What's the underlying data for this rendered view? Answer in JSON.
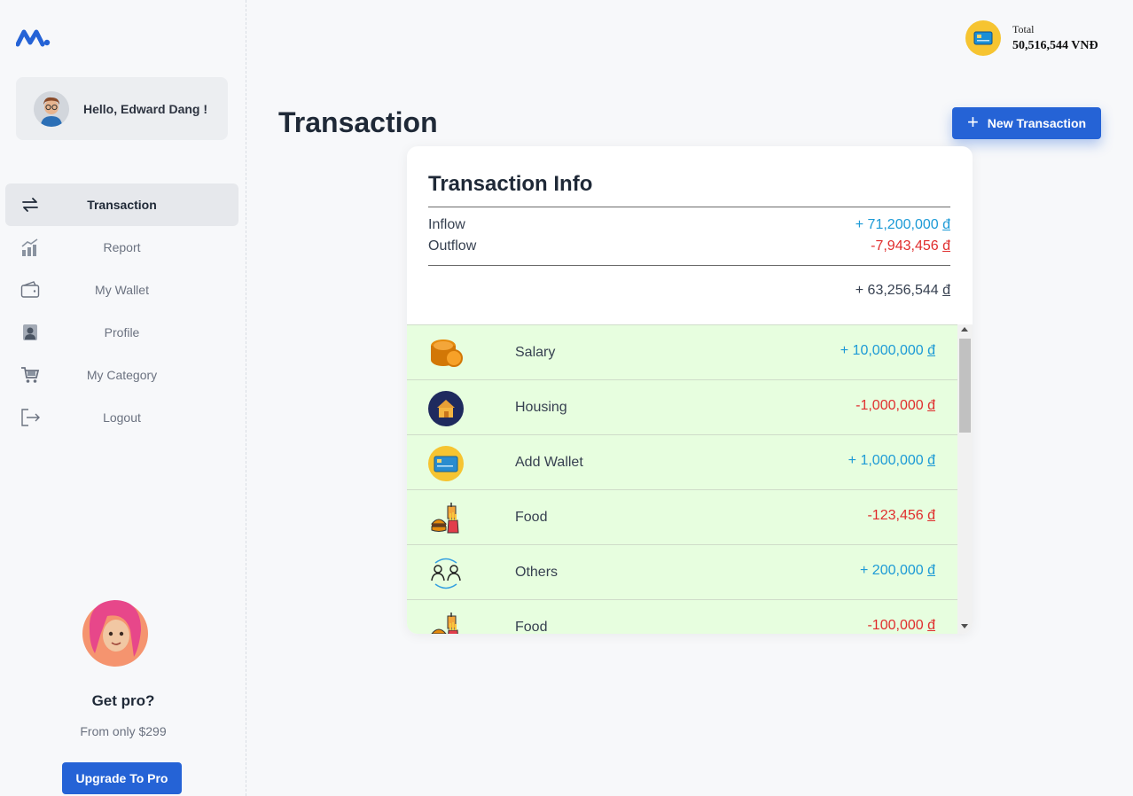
{
  "user": {
    "greeting": "Hello, Edward Dang !"
  },
  "sidebar": {
    "items": [
      {
        "label": "Transaction",
        "icon": "transfer-arrows-icon",
        "active": true
      },
      {
        "label": "Report",
        "icon": "chart-icon"
      },
      {
        "label": "My Wallet",
        "icon": "wallet-icon"
      },
      {
        "label": "Profile",
        "icon": "profile-icon"
      },
      {
        "label": "My Category",
        "icon": "cart-icon"
      },
      {
        "label": "Logout",
        "icon": "logout-icon"
      }
    ]
  },
  "promo": {
    "title": "Get pro?",
    "subtitle": "From only $299",
    "button": "Upgrade To Pro"
  },
  "header": {
    "total_label": "Total",
    "total_value": "50,516,544 VNĐ",
    "page_title": "Transaction",
    "new_button": "New Transaction"
  },
  "info": {
    "title": "Transaction Info",
    "inflow_label": "Inflow",
    "inflow_value": "+ 71,200,000",
    "outflow_label": "Outflow",
    "outflow_value": "-7,943,456",
    "net_value": "+ 63,256,544",
    "currency": "đ"
  },
  "transactions": [
    {
      "name": "Salary",
      "amount": "+ 10,000,000",
      "type": "inflow",
      "icon": "coins-icon"
    },
    {
      "name": "Housing",
      "amount": "-1,000,000",
      "type": "outflow",
      "icon": "house-icon"
    },
    {
      "name": "Add Wallet",
      "amount": "+ 1,000,000",
      "type": "inflow",
      "icon": "credit-card-icon"
    },
    {
      "name": "Food",
      "amount": "-123,456",
      "type": "outflow",
      "icon": "food-icon"
    },
    {
      "name": "Others",
      "amount": "+ 200,000",
      "type": "inflow",
      "icon": "people-exchange-icon"
    },
    {
      "name": "Food",
      "amount": "-100,000",
      "type": "outflow",
      "icon": "food-icon"
    }
  ],
  "colors": {
    "accent": "#2563d6",
    "inflow": "#1c9ad6",
    "outflow": "#e02d2d",
    "row_bg": "#e7fedf"
  }
}
